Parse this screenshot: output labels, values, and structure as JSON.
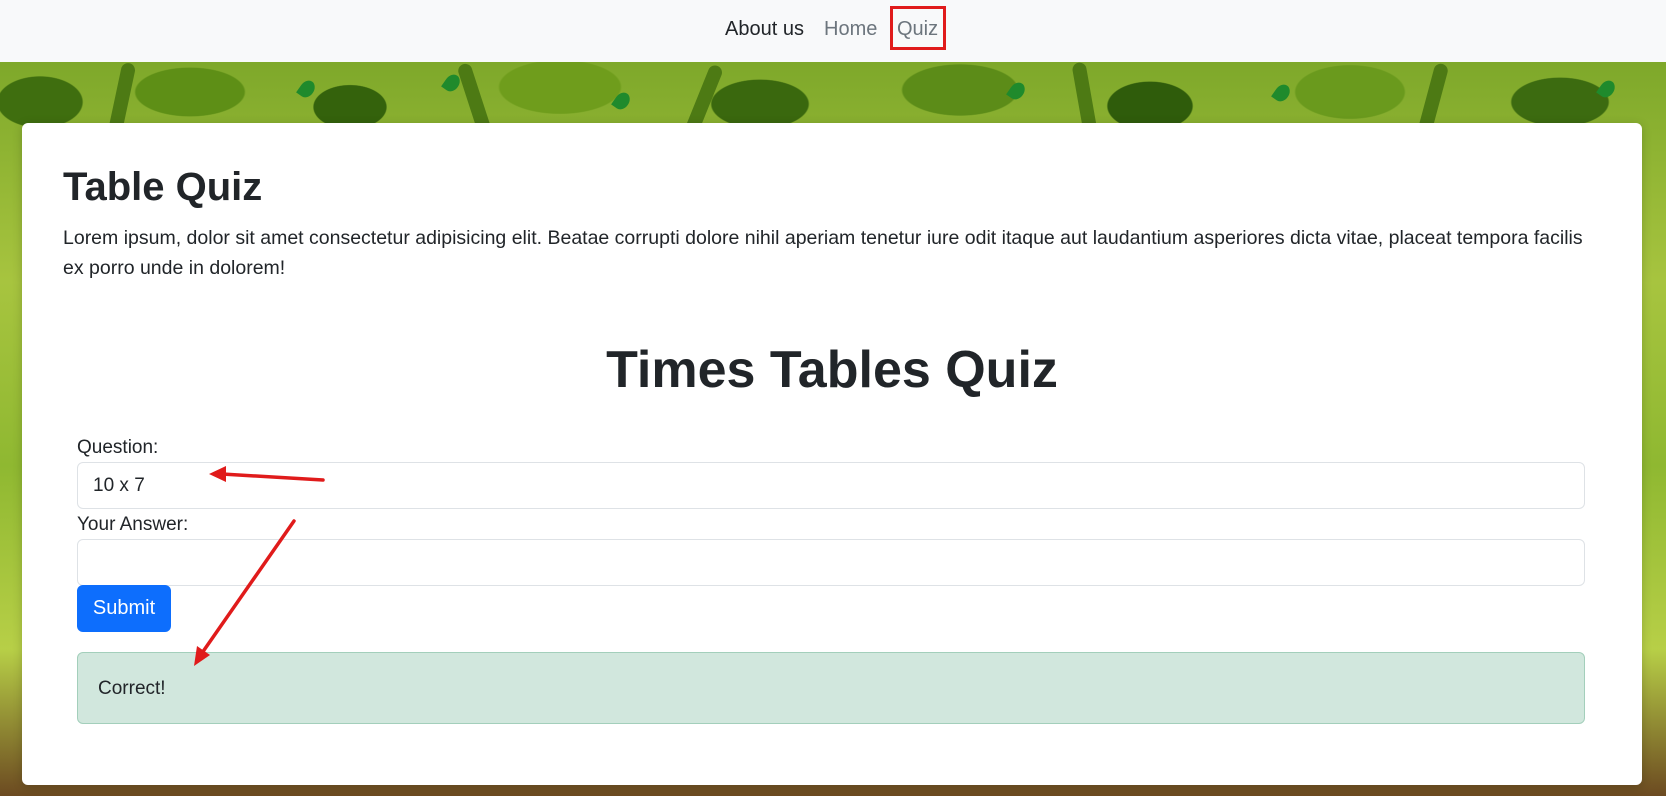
{
  "nav": {
    "items": [
      {
        "label": "About us"
      },
      {
        "label": "Home"
      },
      {
        "label": "Quiz"
      }
    ]
  },
  "main": {
    "title": "Table Quiz",
    "intro": "Lorem ipsum, dolor sit amet consectetur adipisicing elit. Beatae corrupti dolore nihil aperiam tenetur iure odit itaque aut laudantium asperiores dicta vitae, placeat tempora facilis ex porro unde in dolorem!"
  },
  "quiz": {
    "heading": "Times Tables Quiz",
    "question_label": "Question:",
    "question_value": "10 x 7",
    "answer_label": "Your Answer:",
    "answer_value": "",
    "submit_label": "Submit",
    "result_message": "Correct!"
  },
  "colors": {
    "primary": "#0d6efd",
    "success_bg": "#d1e7dd",
    "annotation": "#e01b1b"
  }
}
